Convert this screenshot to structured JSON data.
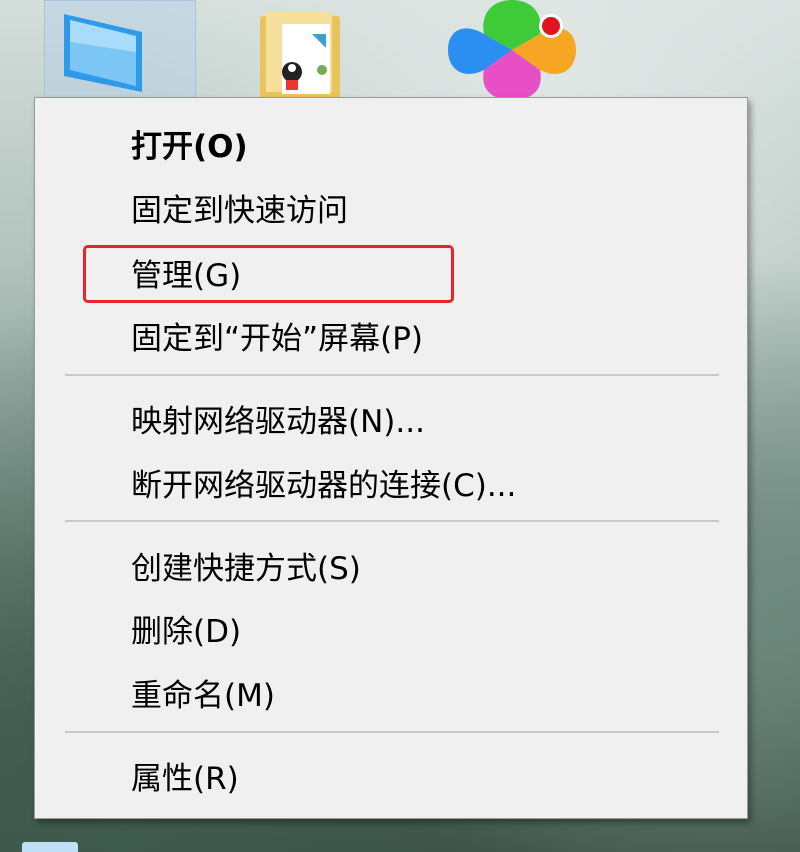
{
  "desktop": {
    "icons": [
      {
        "name": "this-pc-icon"
      },
      {
        "name": "folder-icon"
      },
      {
        "name": "app-icon"
      }
    ]
  },
  "context_menu": {
    "items": [
      {
        "label": "打开(O)",
        "bold": true
      },
      {
        "label": "固定到快速访问"
      },
      {
        "label": "管理(G)"
      },
      {
        "label": "固定到“开始”屏幕(P)"
      },
      {
        "label": "映射网络驱动器(N)..."
      },
      {
        "label": "断开网络驱动器的连接(C)..."
      },
      {
        "label": "创建快捷方式(S)"
      },
      {
        "label": "删除(D)"
      },
      {
        "label": "重命名(M)"
      },
      {
        "label": "属性(R)"
      }
    ],
    "highlighted_item": "管理(G)",
    "highlight_color": "#e8232a"
  }
}
